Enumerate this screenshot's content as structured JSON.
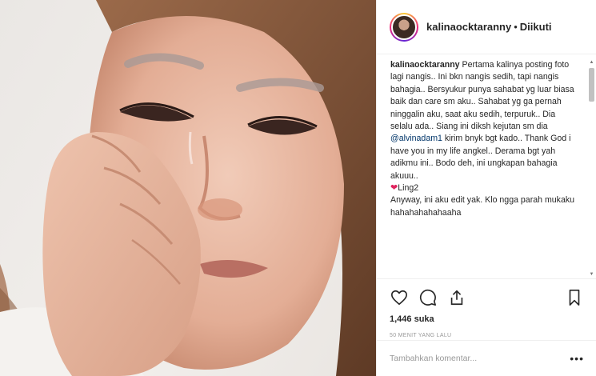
{
  "post": {
    "photo_alt": "Photo of a woman crying, resting her cheek on her hand",
    "photo_colors": {
      "skin": "#e7b8a2",
      "hair": "#7a4f34",
      "background": "#ece9e6"
    }
  },
  "header": {
    "username": "kalinaocktaranny",
    "separator": "•",
    "follow_status": "Diikuti"
  },
  "caption": {
    "username": "kalinaocktaranny",
    "text_1": "Pertama kalinya posting foto lagi nangis.. Ini bkn nangis sedih, tapi nangis bahagia.. Bersyukur punya sahabat yg luar biasa baik dan care sm aku.. Sahabat yg ga pernah ninggalin aku, saat aku sedih, terpuruk.. Dia selalu ada.. Siang ini diksh kejutan sm dia ",
    "mention": "@alvinadam1",
    "text_2": " kirim bnyk bgt kado.. Thank God i have you in my life angkel.. Derama bgt yah adikmu ini.. Bodo deh, ini ungkapan bahagia akuuu..",
    "heart_emoji": "❤",
    "text_3": "Ling2",
    "text_4": "Anyway, ini aku edit yak. Klo ngga parah mukaku hahahahahahaaha"
  },
  "actions": {
    "like_icon": "heart-outline-icon",
    "comment_icon": "comment-bubble-icon",
    "share_icon": "share-paper-plane-icon",
    "save_icon": "bookmark-icon"
  },
  "likes": "1,446 suka",
  "timestamp": "50 MENIT YANG LALU",
  "comment": {
    "placeholder": "Tambahkan komentar...",
    "more_label": "•••"
  },
  "scrollbar": {
    "up_arrow": "▲",
    "down_arrow": "▼"
  }
}
